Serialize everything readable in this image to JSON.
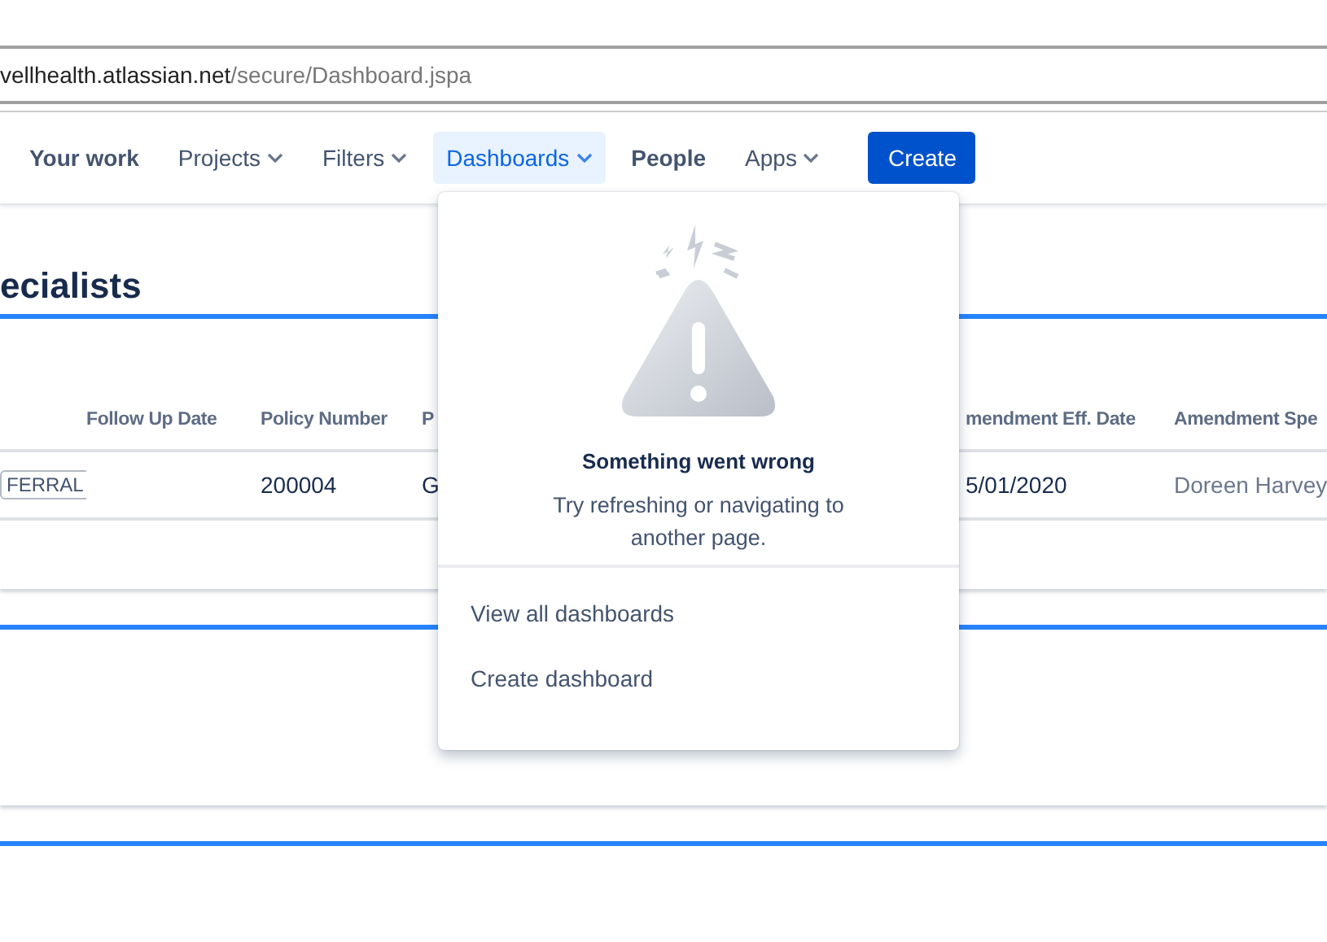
{
  "address_bar": {
    "host": "vellhealth.atlassian.net",
    "path": "/secure/Dashboard.jspa"
  },
  "nav": {
    "items": [
      {
        "label": "Your work",
        "kind": "link",
        "selected": false
      },
      {
        "label": "Projects",
        "kind": "menu",
        "selected": false
      },
      {
        "label": "Filters",
        "kind": "menu",
        "selected": false
      },
      {
        "label": "Dashboards",
        "kind": "menu",
        "selected": true
      },
      {
        "label": "People",
        "kind": "link",
        "selected": false
      },
      {
        "label": "Apps",
        "kind": "menu",
        "selected": false
      }
    ],
    "create_button": "Create"
  },
  "page_title": "ecialists",
  "table": {
    "columns": [
      "",
      "Follow Up Date",
      "Policy Number",
      "P",
      "mendment Eff. Date",
      "Amendment Spe"
    ],
    "rows": [
      [
        "FERRAL",
        "",
        "200004",
        "G",
        "5/01/2020",
        "Doreen Harvey"
      ]
    ]
  },
  "dropdown": {
    "error_title": "Something went wrong",
    "error_message": "Try refreshing or navigating to another page.",
    "items": [
      "View all dashboards",
      "Create dashboard"
    ]
  }
}
